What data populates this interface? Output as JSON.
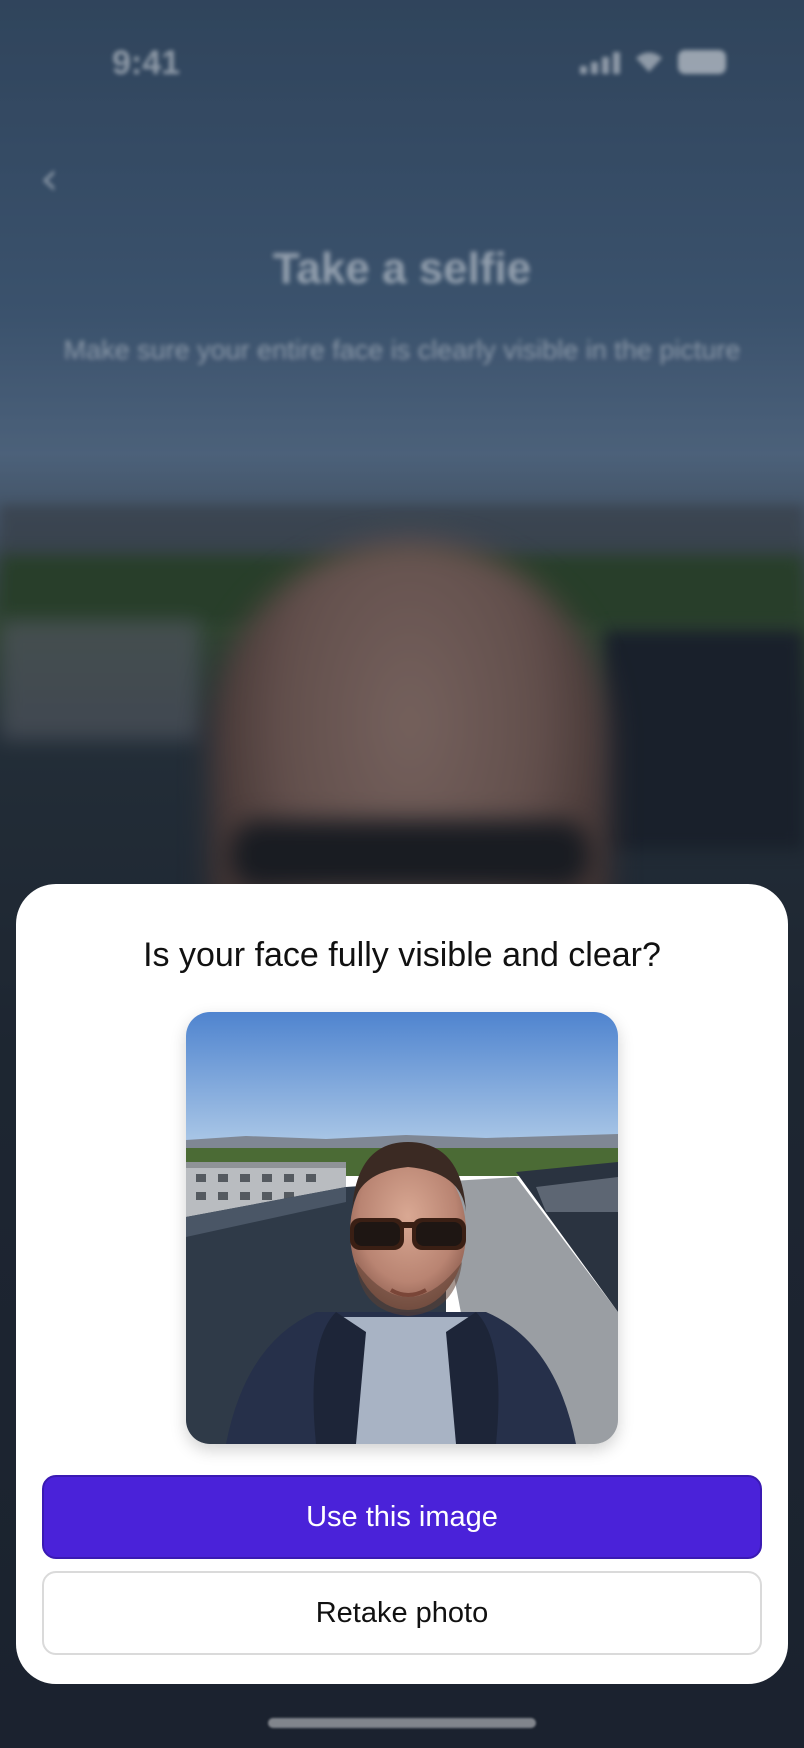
{
  "status_bar": {
    "time": "9:41",
    "icons": [
      "signal-icon",
      "wifi-icon",
      "battery-icon"
    ]
  },
  "header": {
    "back_icon": "chevron-left-icon",
    "title": "Take a selfie",
    "subtitle": "Make sure your entire face is clearly visible in the picture"
  },
  "sheet": {
    "question": "Is your face fully visible and clear?",
    "primary_button": "Use this image",
    "secondary_button": "Retake photo"
  },
  "colors": {
    "primary": "#4a22d9",
    "sheet_background": "#ffffff",
    "secondary_border": "#dadada"
  }
}
